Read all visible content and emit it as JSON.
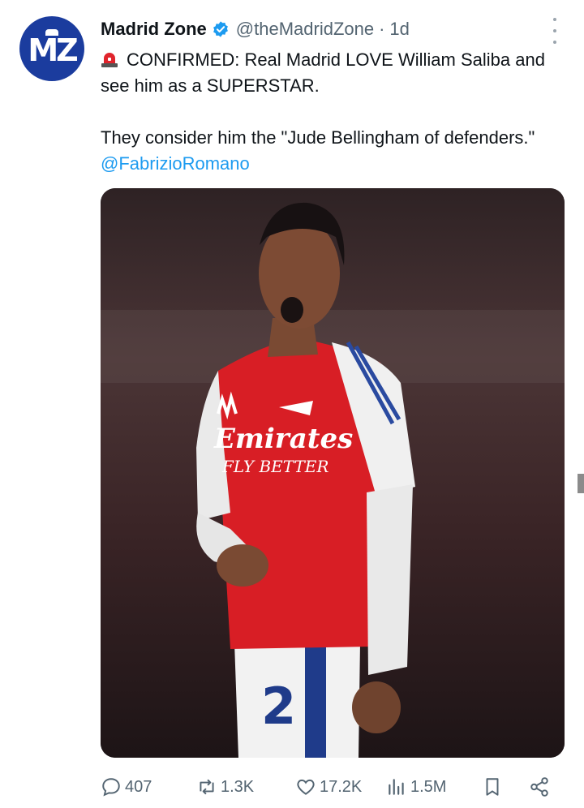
{
  "tweet": {
    "author_name": "Madrid Zone",
    "handle": "@theMadridZone",
    "separator": "·",
    "time": "1d",
    "avatar_text": "MZ",
    "line1": "CONFIRMED: Real Madrid LOVE William Saliba and see him as a SUPERSTAR.",
    "line2": "They consider him the \"Jude Bellingham of defenders.\"",
    "mention": "@FabrizioRomano",
    "image_shirt_text1": "Emirates",
    "image_shirt_text2": "FLY BETTER",
    "image_number": "2"
  },
  "actions": {
    "replies": "407",
    "reposts": "1.3K",
    "likes": "17.2K",
    "views": "1.5M"
  },
  "colors": {
    "accent": "#1d9bf0",
    "text": "#0f1419",
    "muted": "#536471",
    "avatar_bg": "#1b3c9e",
    "shirt_red": "#d81e25"
  },
  "icons": [
    "verified-badge-icon",
    "siren-icon",
    "more-icon",
    "reply-icon",
    "repost-icon",
    "like-icon",
    "views-icon",
    "bookmark-icon",
    "share-icon"
  ]
}
